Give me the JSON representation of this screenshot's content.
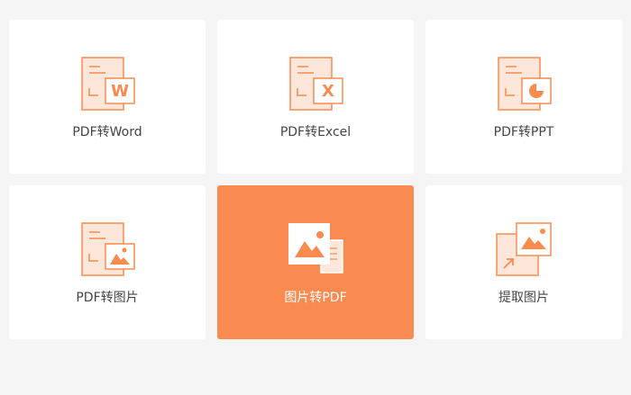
{
  "accent_color": "#f98a50",
  "tiles": [
    {
      "label": "PDF转Word",
      "icon": "pdf-to-word-icon",
      "badge": "W",
      "active": false
    },
    {
      "label": "PDF转Excel",
      "icon": "pdf-to-excel-icon",
      "badge": "X",
      "active": false
    },
    {
      "label": "PDF转PPT",
      "icon": "pdf-to-ppt-icon",
      "badge": "pie",
      "active": false
    },
    {
      "label": "PDF转图片",
      "icon": "pdf-to-image-icon",
      "badge": "image",
      "active": false
    },
    {
      "label": "图片转PDF",
      "icon": "image-to-pdf-icon",
      "badge": "image",
      "active": true
    },
    {
      "label": "提取图片",
      "icon": "extract-image-icon",
      "badge": "image",
      "active": false
    }
  ]
}
